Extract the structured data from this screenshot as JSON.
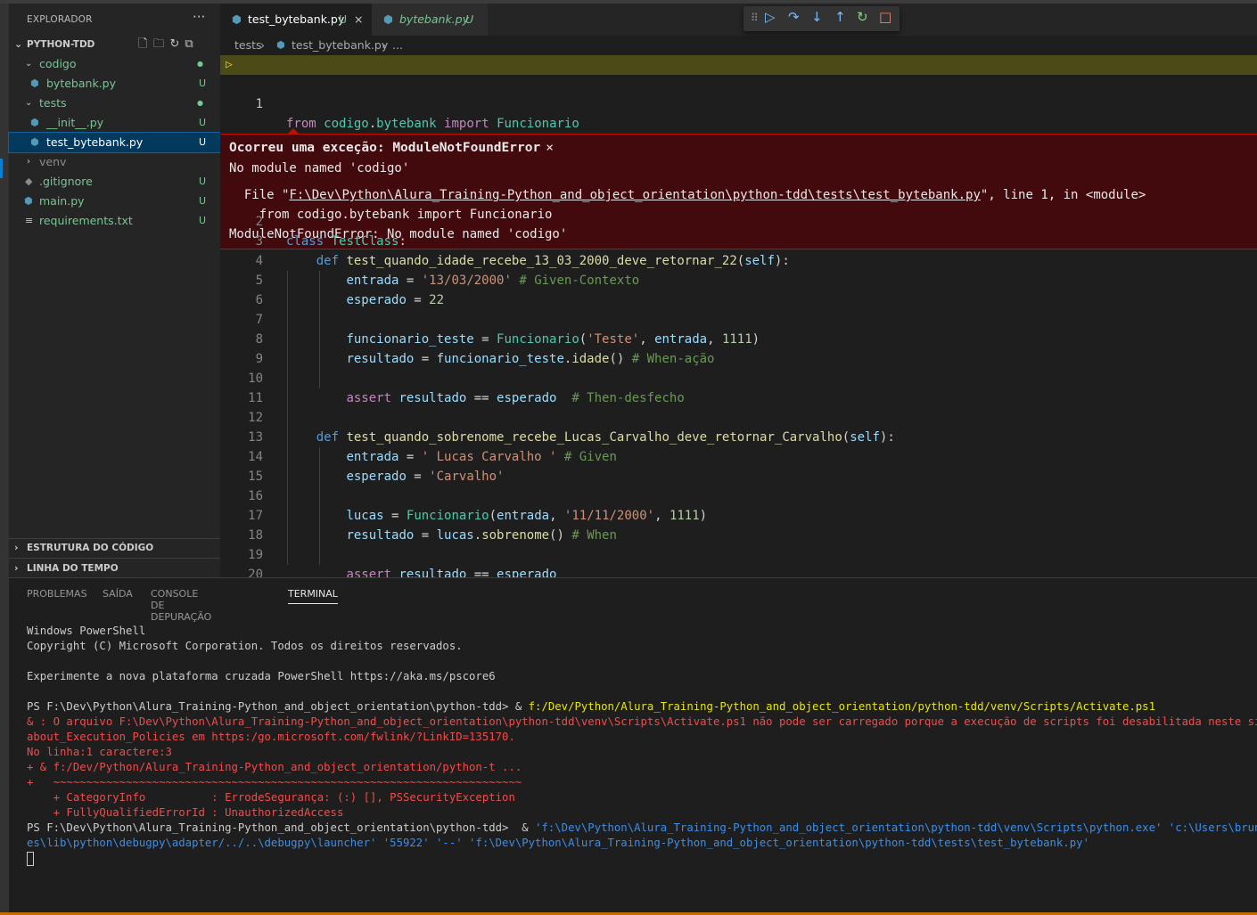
{
  "sidebar": {
    "title": "EXPLORADOR",
    "more": "···",
    "project": "PYTHON-TDD",
    "items": [
      {
        "name": "codigo",
        "badge": "●"
      },
      {
        "name": "bytebank.py",
        "badge": "U"
      },
      {
        "name": "tests",
        "badge": "●"
      },
      {
        "name": "__init__.py",
        "badge": "U"
      },
      {
        "name": "test_bytebank.py",
        "badge": "U"
      },
      {
        "name": "venv",
        "badge": ""
      },
      {
        "name": ".gitignore",
        "badge": "U"
      },
      {
        "name": "main.py",
        "badge": "U"
      },
      {
        "name": "requirements.txt",
        "badge": "U"
      }
    ],
    "outline": "ESTRUTURA DO CÓDIGO",
    "timeline": "LINHA DO TEMPO"
  },
  "tabs": [
    {
      "label": "test_bytebank.py",
      "badge": "U",
      "close": "×"
    },
    {
      "label": "bytebank.py",
      "badge": "U"
    }
  ],
  "breadcrumb": {
    "folder": "tests",
    "file": "test_bytebank.py",
    "more": "..."
  },
  "exception": {
    "title": "Ocorreu uma exceção: ModuleNotFoundError",
    "close": "×",
    "message": "No module named 'codigo'",
    "trace_prefix": "  File \"",
    "trace_path": "F:\\Dev\\Python\\Alura_Training-Python_and_object_orientation\\python-tdd\\tests\\test_bytebank.py",
    "trace_suffix": "\", line 1, in <module>",
    "trace_code": "    from codigo.bytebank import Funcionario",
    "trace_error": "ModuleNotFoundError: No module named 'codigo'"
  },
  "code": {
    "line1": {
      "n": "1",
      "kw": "from",
      "mod1": "codigo",
      "dot": ".",
      "mod2": "bytebank",
      "kw2": "import",
      "cls": "Funcionario"
    },
    "line_numbers": [
      "2",
      "3",
      "4",
      "5",
      "6",
      "7",
      "8",
      "9",
      "10",
      "11",
      "12",
      "13",
      "14",
      "15",
      "16",
      "17",
      "18",
      "19",
      "20"
    ],
    "l3": {
      "kw": "class",
      "name": "TestClass",
      "p": ":"
    },
    "l4": {
      "kw": "def",
      "fn": "test_quando_idade_recebe_13_03_2000_deve_retornar_22",
      "p1": "(",
      "self": "self",
      "p2": "):"
    },
    "l5": {
      "var": "entrada",
      "op": " = ",
      "str": "'13/03/2000'",
      "cmt": " # Given-Contexto"
    },
    "l6": {
      "var": "esperado",
      "op": " = ",
      "num": "22"
    },
    "l8": {
      "var": "funcionario_teste",
      "op": " = ",
      "cls": "Funcionario",
      "p1": "(",
      "str": "'Teste'",
      "c": ", ",
      "var2": "entrada",
      "c2": ", ",
      "num": "1111",
      "p2": ")"
    },
    "l9": {
      "var": "resultado",
      "op": " = ",
      "var2": "funcionario_teste",
      "dot": ".",
      "fn": "idade",
      "p": "()",
      "cmt": " # When-ação"
    },
    "l11": {
      "kw": "assert",
      "var": "resultado",
      "op": " == ",
      "var2": "esperado",
      "cmt": "  # Then-desfecho"
    },
    "l13": {
      "kw": "def",
      "fn": "test_quando_sobrenome_recebe_Lucas_Carvalho_deve_retornar_Carvalho",
      "p1": "(",
      "self": "self",
      "p2": "):"
    },
    "l14": {
      "var": "entrada",
      "op": " = ",
      "str": "' Lucas Carvalho '",
      "cmt": " # Given"
    },
    "l15": {
      "var": "esperado",
      "op": " = ",
      "str": "'Carvalho'"
    },
    "l17": {
      "var": "lucas",
      "op": " = ",
      "cls": "Funcionario",
      "p1": "(",
      "var2": "entrada",
      "c": ", ",
      "str": "'11/11/2000'",
      "c2": ", ",
      "num": "1111",
      "p2": ")"
    },
    "l18": {
      "var": "resultado",
      "op": " = ",
      "var2": "lucas",
      "dot": ".",
      "fn": "sobrenome",
      "p": "()",
      "cmt": " # When"
    },
    "l20": {
      "kw": "assert",
      "var": "resultado",
      "op": " == ",
      "var2": "esperado"
    }
  },
  "panel": {
    "tabs": [
      "PROBLEMAS",
      "SAÍDA",
      "CONSOLE DE DEPURAÇÃO",
      "TERMINAL"
    ],
    "terminal": {
      "l1": "Windows PowerShell",
      "l2": "Copyright (C) Microsoft Corporation. Todos os direitos reservados.",
      "l3": "Experimente a nova plataforma cruzada PowerShell https://aka.ms/pscore6",
      "l4_prompt": "PS F:\\Dev\\Python\\Alura_Training-Python_and_object_orientation\\python-tdd> & ",
      "l4_cmd": "f:/Dev/Python/Alura_Training-Python_and_object_orientation/python-tdd/venv/Scripts/Activate.ps1",
      "e1": "& : O arquivo F:\\Dev\\Python\\Alura_Training-Python_and_object_orientation\\python-tdd\\venv\\Scripts\\Activate.ps1 não pode ser carregado porque a execução de scripts foi desabilitada neste sistema. Par",
      "e2": "about_Execution_Policies em https:/go.microsoft.com/fwlink/?LinkID=135170.",
      "e3": "No linha:1 caractere:3",
      "e4": "+ & f:/Dev/Python/Alura_Training-Python_and_object_orientation/python-t ...",
      "e5": "+   ~~~~~~~~~~~~~~~~~~~~~~~~~~~~~~~~~~~~~~~~~~~~~~~~~~~~~~~~~~~~~~~~~~~~~~~",
      "e6": "    + CategoryInfo          : ErrodeSegurança: (:) [], PSSecurityException",
      "e7": "    + FullyQualifiedErrorId : UnauthorizedAccess",
      "l5_prompt": "PS F:\\Dev\\Python\\Alura_Training-Python_and_object_orientation\\python-tdd>  & ",
      "l5_cmd": "'f:\\Dev\\Python\\Alura_Training-Python_and_object_orientation\\python-tdd\\venv\\Scripts\\python.exe' 'c:\\Users\\bruno\\.vscode\\",
      "l6": "es\\lib\\python\\debugpy\\adapter/../..\\debugpy\\launcher' '55922' '--' 'f:\\Dev\\Python\\Alura_Training-Python_and_object_orientation\\python-tdd\\tests\\test_bytebank.py'"
    }
  },
  "colors": {
    "accent": "#0e639c",
    "error_bg": "#430a0e",
    "untracked": "#73c991",
    "status_bar": "#c36c00"
  }
}
